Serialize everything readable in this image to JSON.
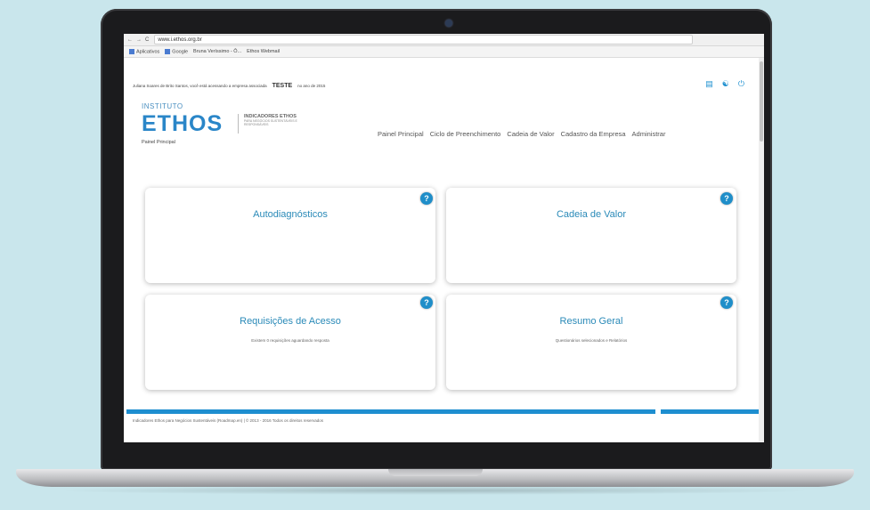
{
  "browser": {
    "url": "www.i.ethos.org.br",
    "nav_back": "←",
    "nav_forward": "→",
    "reload": "C",
    "bookmarks": [
      "Aplicativos",
      "Google",
      "Bruna Veríssimo - Ô...",
      "Ethos Webmail"
    ]
  },
  "header": {
    "user_text": "Juliana Soares de Brito Santos, você está acessando a empresa associada",
    "company": "TESTE",
    "year_text": "no ano de 2015",
    "icons": [
      "document-icon",
      "help-icon",
      "logout-icon"
    ]
  },
  "logo": {
    "pre": "INSTITUTO",
    "main": "ETHOS",
    "side_title": "INDICADORES ETHOS",
    "side_sub": "PARA NEGÓCIOS SUSTENTÁVEIS E RESPONSÁVEIS"
  },
  "breadcrumb": "Painel Principal",
  "nav": {
    "items": [
      "Painel Principal",
      "Ciclo de Preenchimento",
      "Cadeia de Valor",
      "Cadastro da Empresa",
      "Administrar"
    ]
  },
  "cards": [
    {
      "title": "Autodiagnósticos",
      "subtitle": ""
    },
    {
      "title": "Cadeia de Valor",
      "subtitle": ""
    },
    {
      "title": "Requisições de Acesso",
      "subtitle": "Existem 0 requisições aguardando resposta"
    },
    {
      "title": "Resumo Geral",
      "subtitle": "Questionários selecionados e Relatórios"
    }
  ],
  "help_label": "?",
  "footer": "Indicadores Ethos para Negócios Sustentáveis (Roadmap.en) | © 2013 - 2016 Todos os direitos reservados"
}
